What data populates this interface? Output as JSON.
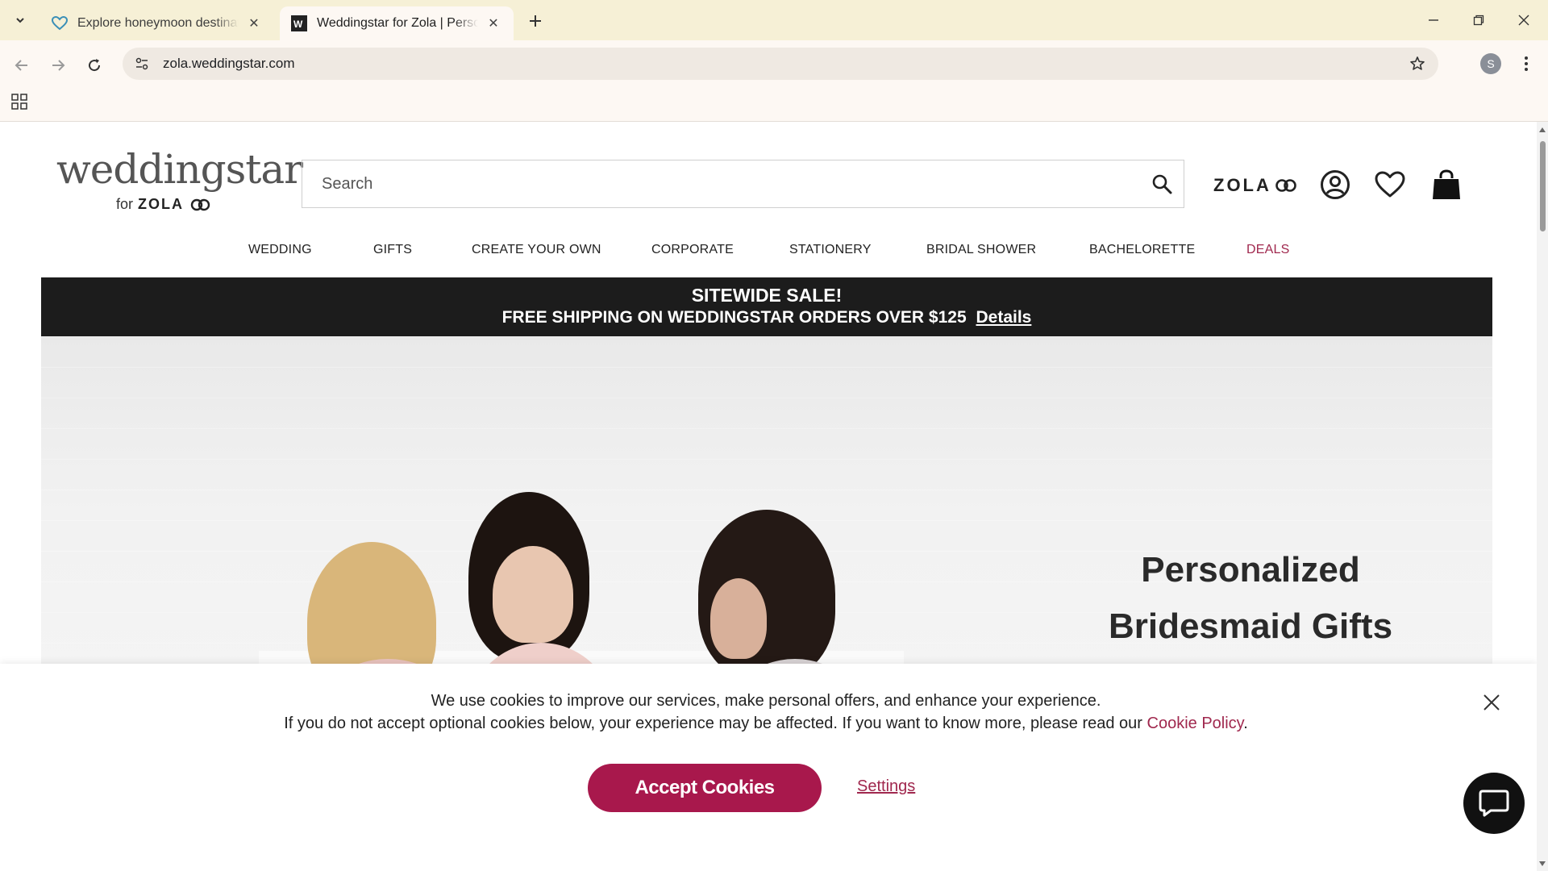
{
  "browser": {
    "tabs": [
      {
        "title": "Explore honeymoon destinations",
        "favicon": "heart-icon",
        "active": false
      },
      {
        "title": "Weddingstar for Zola | Personalized",
        "favicon": "weddingstar-favicon",
        "active": true
      }
    ],
    "url": "zola.weddingstar.com",
    "profile_initial": "S"
  },
  "header": {
    "logo_word": "weddingstar",
    "logo_for": "for",
    "logo_zola": "ZOLA",
    "search_placeholder": "Search",
    "zola_brand": "ZOLA"
  },
  "nav": {
    "items": [
      "WEDDING",
      "GIFTS",
      "CREATE YOUR OWN",
      "CORPORATE",
      "STATIONERY",
      "BRIDAL SHOWER",
      "BACHELORETTE",
      "DEALS"
    ]
  },
  "promo": {
    "line1": "SITEWIDE SALE!",
    "line2": "FREE SHIPPING ON WEDDINGSTAR ORDERS OVER $125",
    "details_link": "Details"
  },
  "hero": {
    "title_line1": "Personalized",
    "title_line2": "Bridesmaid Gifts",
    "prev_label": "‹",
    "next_label": "›"
  },
  "cookie_banner": {
    "line1": "We use cookies to improve our services, make personal offers, and enhance your experience.",
    "line2_prefix": "If you do not accept optional cookies below, your experience may be affected. If you want to know more, please read our",
    "policy_link": "Cookie Policy",
    "line2_suffix": ".",
    "accept_label": "Accept Cookies",
    "settings_label": "Settings"
  },
  "colors": {
    "accent": "#a8184c",
    "link": "#a0284e",
    "promo_bg": "#1c1c1c",
    "tabbar_bg": "#f6f0d6"
  }
}
